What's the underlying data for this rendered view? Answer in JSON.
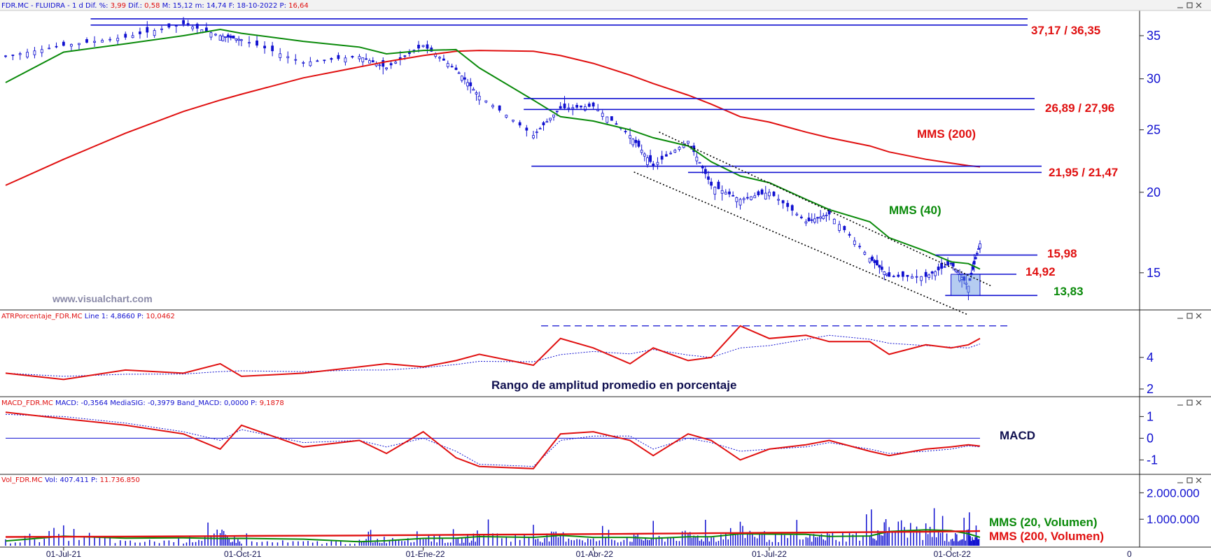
{
  "colors": {
    "blue": "#1010d0",
    "red": "#e01010",
    "green": "#0a8a0a",
    "navy": "#101050",
    "grey": "#8a8aa8"
  },
  "panels": {
    "price": {
      "header": {
        "symbol": "FDR.MC - FLUIDRA - ",
        "tf": " 1 d ",
        "dif_pct_label": "Dif. %: ",
        "dif_pct": "3,99",
        "dif_label": " Dif.: ",
        "dif": "0,58",
        "min_label": " M: ",
        "min": "15,12",
        "low_label": " m: ",
        "low": "14,74",
        "date_label": " F: ",
        "date": "18-10-2022",
        "price_label": " P: ",
        "price": "16,64"
      },
      "watermark": "www.visualchart.com",
      "levels": [
        {
          "text": "37,17 / 36,35",
          "color": "red"
        },
        {
          "text": "26,89 / 27,96",
          "color": "red"
        },
        {
          "text": "21,95 / 21,47",
          "color": "red"
        },
        {
          "text": "15,98",
          "color": "red"
        },
        {
          "text": "14,92",
          "color": "red"
        },
        {
          "text": "13,83",
          "color": "green"
        }
      ],
      "mms200_label": "MMS (200)",
      "mms40_label": "MMS (40)",
      "yticks": [
        "35",
        "30",
        "25",
        "20",
        "15"
      ]
    },
    "atr": {
      "header": {
        "name": "ATRPorcentaje_FDR.MC",
        "line_label": " Line 1: ",
        "line": "4,8660",
        "p_label": " P: ",
        "p": "10,0462"
      },
      "caption": "Rango de amplitud promedio en porcentaje",
      "yticks": [
        "4",
        "2"
      ]
    },
    "macd": {
      "header": {
        "name": "MACD_FDR.MC",
        "macd_label": " MACD: ",
        "macd": "-0,3564",
        "sig_label": " MediaSIG: ",
        "sig": "-0,3979",
        "band_label": " Band_MACD: ",
        "band": "0,0000",
        "p_label": " P: ",
        "p": "9,1878"
      },
      "caption": "MACD",
      "yticks": [
        "1",
        "0",
        "-1"
      ]
    },
    "vol": {
      "header": {
        "name": "Vol_FDR.MC",
        "vol_label": " Vol: ",
        "vol": "407.411",
        "p_label": " P: ",
        "p": "11.736.850"
      },
      "legend20": "MMS (20, Volumen)",
      "legend200": "MMS (200, Volumen)",
      "yticks": [
        "2.000.000",
        "1.000.000"
      ]
    }
  },
  "xaxis": [
    "01-Jul-21",
    "01-Oct-21",
    "01-Ene-22",
    "01-Abr-22",
    "01-Jul-22",
    "01-Oct-22",
    "0"
  ],
  "chart_data": {
    "type": "line",
    "scale": "log",
    "x_start": "2021-06-01",
    "x_end": "2022-10-18",
    "x_dates": [
      "2021-06-01",
      "2021-07-01",
      "2021-08-02",
      "2021-09-01",
      "2021-09-20",
      "2021-10-01",
      "2021-11-02",
      "2021-12-01",
      "2021-12-15",
      "2022-01-03",
      "2022-01-20",
      "2022-02-01",
      "2022-03-01",
      "2022-03-15",
      "2022-04-01",
      "2022-04-20",
      "2022-05-02",
      "2022-05-20",
      "2022-06-01",
      "2022-06-16",
      "2022-07-01",
      "2022-07-20",
      "2022-08-01",
      "2022-08-22",
      "2022-09-01",
      "2022-09-20",
      "2022-10-03",
      "2022-10-12",
      "2022-10-18"
    ],
    "close": [
      32.5,
      33.8,
      34.8,
      36.5,
      35.0,
      34.5,
      31.8,
      32.5,
      31.2,
      33.8,
      31.0,
      28.2,
      24.5,
      27.0,
      27.2,
      24.5,
      22.0,
      24.0,
      20.5,
      19.5,
      20.0,
      18.0,
      18.5,
      15.8,
      14.8,
      14.8,
      15.5,
      14.3,
      16.64
    ],
    "sma40": [
      29.6,
      33.0,
      34.0,
      35.0,
      35.8,
      35.3,
      34.3,
      33.6,
      32.8,
      33.2,
      33.3,
      31.2,
      27.8,
      26.2,
      25.8,
      25.0,
      24.3,
      23.6,
      22.3,
      21.2,
      20.7,
      19.5,
      18.8,
      18.0,
      17.0,
      16.2,
      15.6,
      15.5,
      15.2
    ],
    "sma200": [
      20.5,
      22.5,
      24.7,
      26.7,
      27.8,
      28.4,
      30.1,
      31.3,
      31.9,
      32.6,
      33.1,
      33.2,
      33.1,
      32.6,
      31.7,
      30.4,
      29.5,
      28.3,
      27.4,
      26.2,
      25.7,
      24.8,
      24.3,
      23.6,
      23.1,
      22.5,
      22.2,
      22.0,
      21.9
    ],
    "resistance_levels": [
      37.17,
      36.35,
      27.96,
      26.89,
      21.95,
      21.47,
      15.98,
      14.92,
      13.83
    ],
    "atr_percent": [
      3.0,
      2.6,
      3.2,
      3.0,
      3.6,
      2.8,
      3.0,
      3.4,
      3.6,
      3.4,
      3.8,
      4.2,
      3.5,
      5.2,
      4.6,
      3.6,
      4.6,
      3.8,
      4.0,
      6.0,
      5.2,
      5.4,
      5.0,
      5.0,
      4.2,
      4.8,
      4.6,
      4.8,
      5.2
    ],
    "macd": [
      1.2,
      0.9,
      0.6,
      0.2,
      -0.5,
      0.6,
      -0.4,
      -0.1,
      -0.7,
      0.3,
      -0.9,
      -1.3,
      -1.4,
      0.2,
      0.3,
      -0.1,
      -0.8,
      0.2,
      -0.1,
      -1.0,
      -0.5,
      -0.3,
      -0.1,
      -0.6,
      -0.8,
      -0.5,
      -0.4,
      -0.3,
      -0.36
    ],
    "signal": [
      1.1,
      1.0,
      0.7,
      0.3,
      -0.1,
      0.4,
      -0.2,
      -0.1,
      -0.4,
      0.0,
      -0.6,
      -1.2,
      -1.3,
      -0.1,
      0.1,
      0.1,
      -0.5,
      0.0,
      -0.2,
      -0.6,
      -0.5,
      -0.4,
      -0.2,
      -0.5,
      -0.7,
      -0.6,
      -0.5,
      -0.35,
      -0.4
    ],
    "volume": [
      400000,
      1200000,
      300000,
      500000,
      1000000,
      350000,
      300000,
      350000,
      600000,
      900000,
      400000,
      1000000,
      700000,
      900000,
      500000,
      700000,
      650000,
      900000,
      700000,
      1400000,
      800000,
      650000,
      900000,
      900000,
      1800000,
      1300000,
      700000,
      1000000,
      407411
    ]
  }
}
